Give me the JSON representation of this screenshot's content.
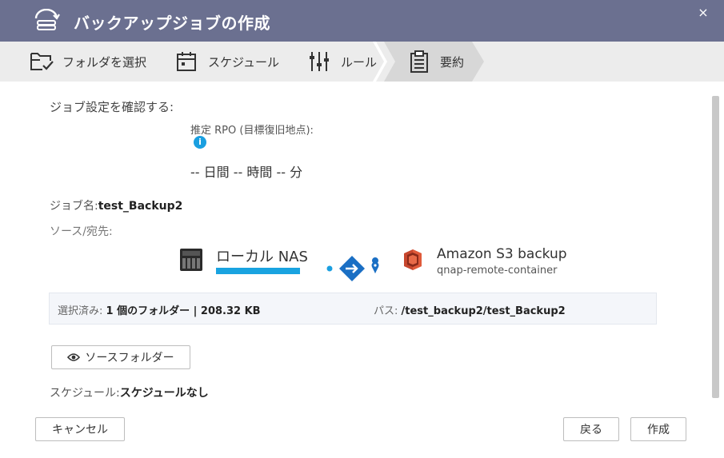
{
  "window": {
    "title": "バックアップジョブの作成",
    "close_glyph": "×"
  },
  "steps": [
    {
      "label": "フォルダを選択",
      "icon": "folder-check-icon"
    },
    {
      "label": "スケジュール",
      "icon": "calendar-icon"
    },
    {
      "label": "ルール",
      "icon": "sliders-icon"
    },
    {
      "label": "要約",
      "icon": "clipboard-icon",
      "active": true
    }
  ],
  "summary": {
    "heading": "ジョブ設定を確認する:",
    "rpo_label": "推定 RPO (目標復旧地点):",
    "info_glyph": "i",
    "rpo_value": "-- 日間 -- 時間 -- 分",
    "job_name_label": "ジョブ名:",
    "job_name_value": "test_Backup2",
    "source_dest_label": "ソース/宛先:",
    "source": {
      "name": "ローカル NAS"
    },
    "destination": {
      "name": "Amazon S3 backup",
      "sub": "qnap-remote-container"
    },
    "selected_label": "選択済み:",
    "selected_value": "1 個のフォルダー | 208.32 KB",
    "path_label": "パス:",
    "path_value": "/test_backup2/test_Backup2",
    "source_folder_button": "ソースフォルダー",
    "schedule_label": "スケジュール:",
    "schedule_value": "スケジュールなし"
  },
  "footer": {
    "cancel": "キャンセル",
    "back": "戻る",
    "create": "作成"
  },
  "colors": {
    "titlebar": "#6b7090",
    "accent": "#1a9fe0",
    "flow_blue": "#1a6fc4",
    "s3_red": "#e05a3a"
  }
}
